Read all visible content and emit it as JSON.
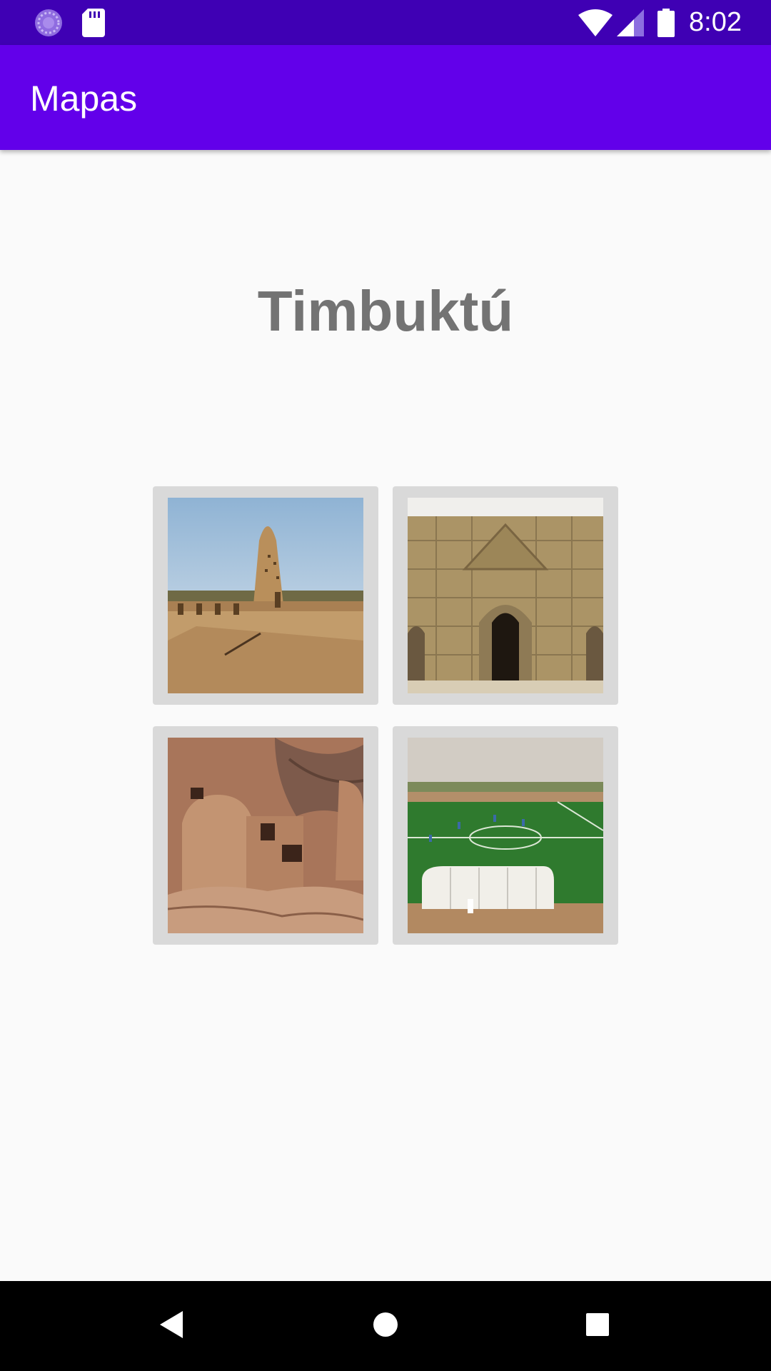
{
  "status_bar": {
    "time": "8:02",
    "icons": [
      "sync-circle-icon",
      "sd-card-icon",
      "wifi-icon",
      "cell-signal-icon",
      "battery-icon"
    ]
  },
  "app_bar": {
    "title": "Mapas"
  },
  "place": {
    "title": "Timbuktú"
  },
  "gallery": {
    "images": [
      {
        "name": "mud-mosque-minaret-photo"
      },
      {
        "name": "mud-brick-doorway-photo"
      },
      {
        "name": "cliff-dwellings-photo"
      },
      {
        "name": "football-field-photo"
      }
    ]
  },
  "nav_bar": {
    "icons": [
      "back-icon",
      "home-icon",
      "recents-icon"
    ]
  },
  "colors": {
    "status_bar": "#3f00b4",
    "app_bar": "#6200ea",
    "background": "#fafafa",
    "title_text": "#737373",
    "tile_frame": "#d9d9d9"
  }
}
